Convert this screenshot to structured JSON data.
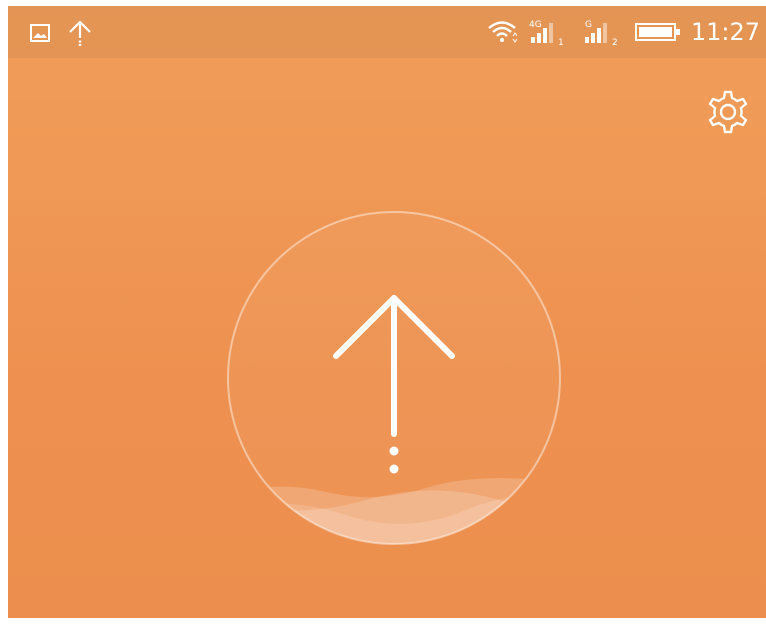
{
  "status_bar": {
    "time": "11:27",
    "left_icons": [
      "image-icon",
      "upload-icon"
    ],
    "right_icons": [
      "wifi-icon",
      "signal-4g-sim1-icon",
      "signal-g-sim2-icon",
      "battery-icon"
    ],
    "sim1_network": "4G",
    "sim2_network": "G",
    "sim1_slot": "1",
    "sim2_slot": "2"
  },
  "header": {
    "settings_icon": "gear-icon"
  },
  "main": {
    "action_icon": "upload-arrow-icon"
  },
  "colors": {
    "background_top": "#f19e5a",
    "background_bottom": "#ec8f4e",
    "foreground": "#ffffff"
  }
}
